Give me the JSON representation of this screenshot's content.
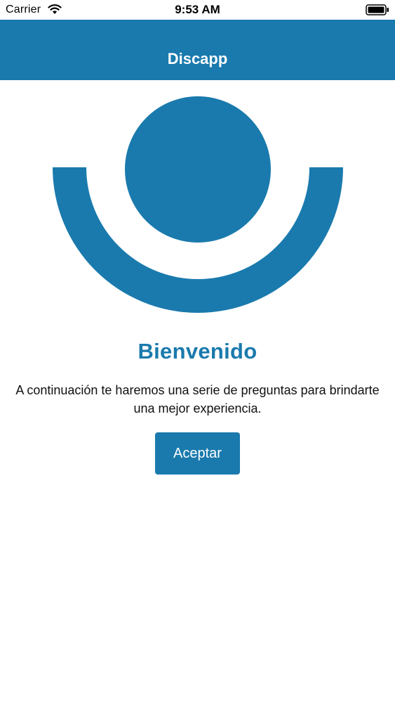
{
  "status_bar": {
    "carrier": "Carrier",
    "time": "9:53 AM",
    "wifi_icon": "wifi-icon",
    "battery_icon": "battery-icon"
  },
  "nav": {
    "title": "Discapp"
  },
  "logo": {
    "icon": "discapp-logo-icon",
    "color": "#1a7aad"
  },
  "welcome": {
    "title": "Bienvenido",
    "description": "A continuación te haremos una serie de preguntas para brindarte una mejor experiencia."
  },
  "actions": {
    "accept_label": "Aceptar"
  },
  "colors": {
    "primary": "#1a7aad",
    "background": "#ffffff"
  }
}
